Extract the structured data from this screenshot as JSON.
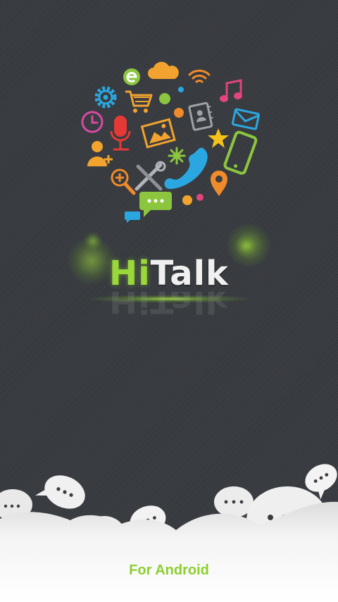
{
  "app": {
    "logo_part1": "Hi",
    "logo_part2": "Talk",
    "tagline": "For Android"
  },
  "colors": {
    "background": "#3a3d42",
    "accent_green": "#9ad83a",
    "footer_green": "#8ccf2e",
    "cloud_white": "#f2f2f2"
  },
  "icons": [
    "browser-e-icon",
    "cloud-icon",
    "wifi-icon",
    "gear-icon",
    "shopping-cart-icon",
    "music-note-icon",
    "clock-icon",
    "microphone-icon",
    "photo-icon",
    "contacts-book-icon",
    "envelope-icon",
    "user-add-icon",
    "star-icon",
    "phone-handset-icon",
    "tablet-icon",
    "zoom-in-icon",
    "tools-icon",
    "location-pin-icon",
    "chat-bubble-icon"
  ]
}
